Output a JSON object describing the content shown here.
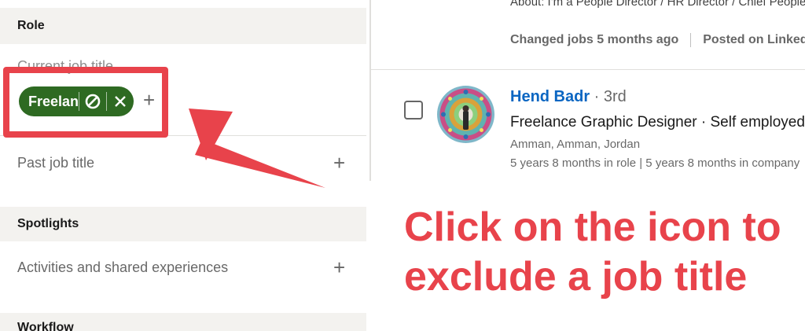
{
  "filters": {
    "role_header": "Role",
    "current_job_title_label": "Current job title",
    "chip_text": "Freelance",
    "past_job_title_label": "Past job title",
    "spotlights_header": "Spotlights",
    "activities_label": "Activities and shared experiences",
    "workflow_header": "Workflow"
  },
  "results": {
    "about_text": "About: I'm a People Director / HR Director / Chief People",
    "changed_jobs": "Changed jobs 5 months ago",
    "posted_on": "Posted on LinkedIn",
    "candidate": {
      "name": "Hend Badr",
      "degree": " · 3rd",
      "headline": "Freelance Graphic Designer · Self employed",
      "location": "Amman, Amman, Jordan",
      "tenure": "5 years 8 months in role | 5 years 8 months in company"
    }
  },
  "annotation": {
    "line1": "Click on the icon to",
    "line2": "exclude a job title"
  },
  "icons": {
    "exclude": "exclude-icon",
    "remove": "close-icon",
    "add": "plus-icon"
  },
  "colors": {
    "chip_green": "#2e6a22",
    "annotation_red": "#e8434b",
    "link_blue": "#0a66c2",
    "section_gray": "#f3f2ef"
  }
}
